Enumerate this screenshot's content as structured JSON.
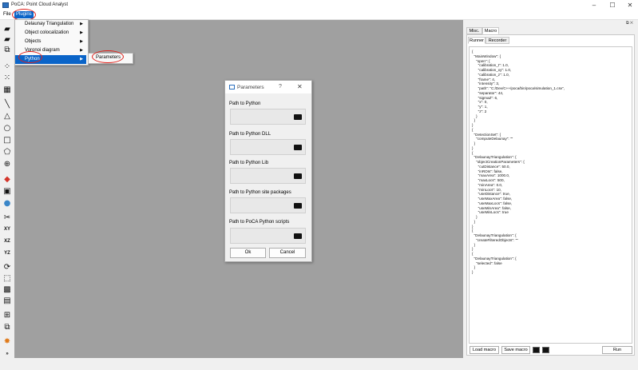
{
  "window": {
    "title": "PoCA: Point Cloud Analyst",
    "controls": {
      "minimize": "–",
      "maximize": "☐",
      "close": "✕"
    }
  },
  "menubar": {
    "file": "File",
    "plugins": "Plugins"
  },
  "plugins_menu": {
    "items": [
      {
        "label": "Delaunay Triangulation",
        "has_submenu": true
      },
      {
        "label": "Object colocalization",
        "has_submenu": true
      },
      {
        "label": "Objects",
        "has_submenu": true
      },
      {
        "label": "Voronoi diagram",
        "has_submenu": true
      },
      {
        "label": "Python",
        "has_submenu": true,
        "highlighted": true
      }
    ]
  },
  "python_submenu": {
    "items": [
      {
        "label": "Parameters"
      }
    ]
  },
  "toolbar": {
    "icons": [
      "folder-open-icon",
      "folder-open-icon",
      "import-icon",
      "scatter-icon",
      "scatter-select-icon",
      "grid-icon",
      "line-tool-icon",
      "triangle-tool-icon",
      "circle-tool-icon",
      "square-tool-icon",
      "polygon-tool-icon",
      "crosshair-icon",
      "color-map-icon",
      "palette-icon",
      "sphere-icon",
      "cut-icon",
      "view-xy",
      "view-xz",
      "view-yz",
      "rotate-icon",
      "bounding-box-icon",
      "grid-toggle-icon",
      "font-size-icon",
      "tile-icon",
      "copy-icon",
      "python-icon",
      "more-icon"
    ],
    "labels": {
      "xy": "XY",
      "xz": "XZ",
      "yz": "YZ",
      "more": "»"
    }
  },
  "dialog": {
    "title": "Parameters",
    "help": "?",
    "close": "✕",
    "fields": [
      {
        "label": "Path to Python",
        "value": ""
      },
      {
        "label": "Path to Python DLL",
        "value": ""
      },
      {
        "label": "Path to Python Lib",
        "value": ""
      },
      {
        "label": "Path to Python site packages",
        "value": ""
      },
      {
        "label": "Path to PoCA Python scripts",
        "value": ""
      }
    ],
    "ok": "Ok",
    "cancel": "Cancel"
  },
  "right_panel": {
    "top_tabs": [
      "Misc.",
      "Macro"
    ],
    "active_top_tab": "Macro",
    "sub_tabs": [
      "Runner",
      "Recorder"
    ],
    "active_sub_tab": "Runner",
    "macro_text": "{\n  \"MainWindow\": {\n    \"open\": {\n      \"calibration_t\": 1.0,\n      \"calibration_xy\": 1.0,\n      \"calibration_z\": 1.0,\n      \"frame\": 4,\n      \"intensity\": 3,\n      \"path\": \"C:/Dev/C++/poca/bin/poca/simulation_1.csv\",\n      \"separator\": 44,\n      \"sigmaZ\": 6,\n      \"x\": 0,\n      \"y\": 1,\n      \"z\": 2\n    }\n  }\n}\n{\n  \"DetectionSet\": {\n    \"computeDelaunay\": \"\"\n  }\n}\n{\n  \"DelaunayTriangulation\": {\n    \"objectCreationParameters\": {\n      \"cutDistance\": 50.0,\n      \"inROIs\": false,\n      \"maxArea\": 1000.0,\n      \"maxLocs\": 500,\n      \"minArea\": 0.0,\n      \"minLocs\": 10,\n      \"useDistance\": true,\n      \"useMaxArea\": false,\n      \"useMaxLocs\": false,\n      \"useMinArea\": false,\n      \"useMinLocs\": true\n    }\n  }\n}\n{\n  \"DelaunayTriangulation\": {\n    \"createFilteredObjects\": \"\"\n  }\n}\n{\n  \"DelaunayTriangulation\": {\n    \"selected\": false\n  }\n}",
    "load_macro": "Load macro",
    "save_macro": "Save macro",
    "run": "Run",
    "float_controls": "⧉ ✕"
  },
  "annotation_color": "#e0201a",
  "highlight_color": "#0a64c8"
}
